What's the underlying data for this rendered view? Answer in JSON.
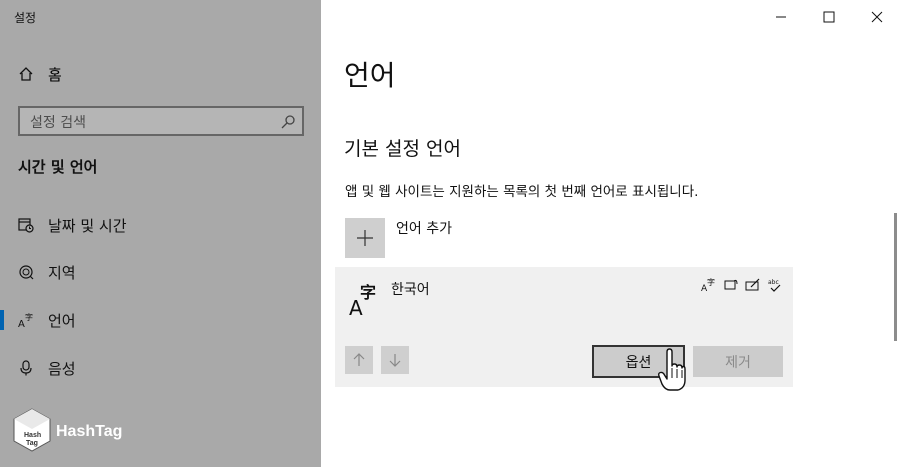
{
  "window": {
    "app_title": "설정"
  },
  "sidebar": {
    "home_label": "홈",
    "search_placeholder": "설정 검색",
    "section_title": "시간 및 언어",
    "items": [
      {
        "label": "날짜 및 시간",
        "icon": "calendar-clock-icon"
      },
      {
        "label": "지역",
        "icon": "globe-icon"
      },
      {
        "label": "언어",
        "icon": "language-icon",
        "active": true
      },
      {
        "label": "음성",
        "icon": "microphone-icon"
      }
    ]
  },
  "logo": {
    "text": "HashTag",
    "cube_text": "Hash Tag"
  },
  "main": {
    "title": "언어",
    "subtitle": "기본 설정 언어",
    "description": "앱 및 웹 사이트는 지원하는 목록의 첫 번째 언어로 표시됩니다.",
    "add_label": "언어 추가",
    "language": {
      "name": "한국어",
      "options_label": "옵션",
      "remove_label": "제거"
    }
  },
  "colors": {
    "sidebar_bg": "#a9a9a9",
    "accent": "#0063b1",
    "card_bg": "#f0f0f0",
    "button_bg": "#cccccc"
  }
}
